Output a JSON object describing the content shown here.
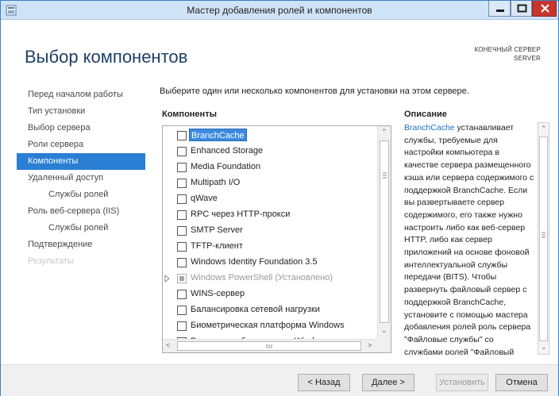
{
  "window": {
    "title": "Мастер добавления ролей и компонентов"
  },
  "header": {
    "page_title": "Выбор компонентов",
    "destination_label": "КОНЕЧНЫЙ СЕРВЕР",
    "destination_server": "SERVER"
  },
  "nav": {
    "items": [
      {
        "label": "Перед началом работы",
        "state": "normal"
      },
      {
        "label": "Тип установки",
        "state": "normal"
      },
      {
        "label": "Выбор сервера",
        "state": "normal"
      },
      {
        "label": "Роли сервера",
        "state": "normal"
      },
      {
        "label": "Компоненты",
        "state": "active"
      },
      {
        "label": "Удаленный доступ",
        "state": "normal"
      },
      {
        "label": "Службы ролей",
        "state": "sub"
      },
      {
        "label": "Роль веб-сервера (IIS)",
        "state": "normal"
      },
      {
        "label": "Службы ролей",
        "state": "sub"
      },
      {
        "label": "Подтверждение",
        "state": "normal"
      },
      {
        "label": "Результаты",
        "state": "disabled"
      }
    ]
  },
  "main": {
    "instruction": "Выберите один или несколько компонентов для установки на этом сервере.",
    "components_header": "Компоненты",
    "description_header": "Описание",
    "components": [
      {
        "label": "BranchCache",
        "checked": false,
        "selected": true
      },
      {
        "label": "Enhanced Storage",
        "checked": false
      },
      {
        "label": "Media Foundation",
        "checked": false
      },
      {
        "label": "Multipath I/O",
        "checked": false
      },
      {
        "label": "qWave",
        "checked": false
      },
      {
        "label": "RPC через HTTP-прокси",
        "checked": false
      },
      {
        "label": "SMTP Server",
        "checked": false
      },
      {
        "label": "TFTP-клиент",
        "checked": false
      },
      {
        "label": "Windows Identity Foundation 3.5",
        "checked": false
      },
      {
        "label": "Windows PowerShell (Установлено)",
        "checked": "partial",
        "expandable": true,
        "disabled": true
      },
      {
        "label": "WINS-сервер",
        "checked": false
      },
      {
        "label": "Балансировка сетевой нагрузки",
        "checked": false
      },
      {
        "label": "Биометрическая платформа Windows",
        "checked": false
      },
      {
        "label": "Внутренняя база данных Windows",
        "checked": true
      }
    ],
    "description_link": "BranchCache",
    "description_text": " устанавливает службы, требуемые для настройки компьютера в качестве сервера размещенного кэша или сервера содержимого с поддержкой BranchCache. Если вы развертываете сервер содержимого, его также нужно настроить либо как веб-сервер HTTP, либо как сервер приложений на основе фоновой интеллектуальной службы передачи (BITS). Чтобы развернуть файловый сервер с поддержкой BranchCache, установите с помощью мастера добавления ролей роль сервера \"Файловые службы\" со службами ролей \"Файловый сервер\" и \"\"BranchCache для"
  },
  "footer": {
    "back_label": "< Назад",
    "next_label": "Далее >",
    "install_label": "Установить",
    "cancel_label": "Отмена"
  },
  "colors": {
    "accent": "#2a7fd4",
    "title_blue": "#1e3f66",
    "close_red": "#c7352f"
  }
}
